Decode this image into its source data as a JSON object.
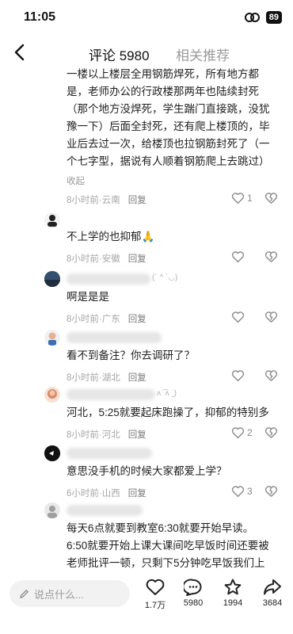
{
  "status": {
    "time": "11:05",
    "battery": "89"
  },
  "header": {
    "tab_comments": "评论 5980",
    "tab_related": "相关推荐"
  },
  "comments": [
    {
      "text_lines": [
        "一楼以上楼层全用钢筋焊死，所有地方都",
        "是，老师办公的行政楼那两年也陆续封死",
        "（那个地方没焊死，学生踹门直接跳，没犹",
        "豫一下）后面全封死，还有爬上楼顶的，毕",
        "业后去过一次，给楼顶也拉钢筋封死了（一",
        "个七字型，据说有人顺着钢筋爬上去跳过）"
      ],
      "collapse": "收起",
      "time": "8小时前",
      "location": "云南",
      "reply": "回复",
      "likes": "1"
    },
    {
      "text": "不上学的也抑郁🙏",
      "time": "8小时前",
      "location": "安徽",
      "reply": "回复",
      "likes": ""
    },
    {
      "username_tail": "(´ ^ `◡)",
      "text": "啊是是是",
      "time": "8小时前",
      "location": "广东",
      "reply": "回复",
      "likes": ""
    },
    {
      "text": "看不到备注？你去调研了？",
      "time": "8小时前",
      "location": "湖北",
      "reply": "回复",
      "likes": ""
    },
    {
      "username_tail": "ʌ  ͡ ʌ ꞈ)",
      "text": "河北，5:25就要起床跑操了，抑郁的特别多",
      "time": "8小时前",
      "location": "河北",
      "reply": "回复",
      "likes": "2"
    },
    {
      "text": "意思没手机的时候大家都爱上学？",
      "time": "6小时前",
      "location": "山西",
      "reply": "回复",
      "likes": "3"
    },
    {
      "text_lines": [
        "每天6点就要到教室6:30就要开始早读。",
        "6:50就要开始上课大课间吃早饭时间还要被",
        "老师批评一顿，只剩下5分钟吃早饭我们上"
      ]
    }
  ],
  "meta_separator": "·",
  "bottom": {
    "input_placeholder": "说点什么...",
    "likes_count": "1.7万",
    "comments_count": "5980",
    "favorites_count": "1994",
    "shares_count": "3684"
  }
}
